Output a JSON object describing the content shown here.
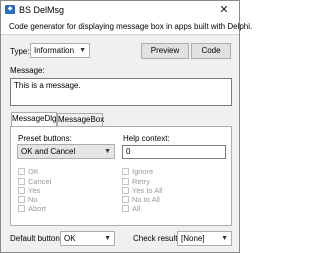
{
  "window": {
    "title": "BS DelMsg",
    "close_glyph": "✕"
  },
  "description": "Code generator for displaying message box in apps built with Delphi.",
  "type": {
    "label": "Type:",
    "value": "Information"
  },
  "preview_label": "Preview",
  "code_label": "Code",
  "message": {
    "label": "Message:",
    "value": "This is a message."
  },
  "tabs": [
    {
      "label": "MessageDlg"
    },
    {
      "label": "MessageBox"
    }
  ],
  "preset": {
    "label": "Preset buttons:",
    "value": "OK and Cancel"
  },
  "help": {
    "label": "Help context:",
    "value": "0"
  },
  "buttons_left": [
    "OK",
    "Cancel",
    "Yes",
    "No",
    "Abort"
  ],
  "buttons_right": [
    "Ignore",
    "Retry",
    "Yes to All",
    "No to All",
    "All"
  ],
  "default_button": {
    "label": "Default button:",
    "value": "OK"
  },
  "check_result": {
    "label": "Check result:",
    "value": "[None]"
  }
}
